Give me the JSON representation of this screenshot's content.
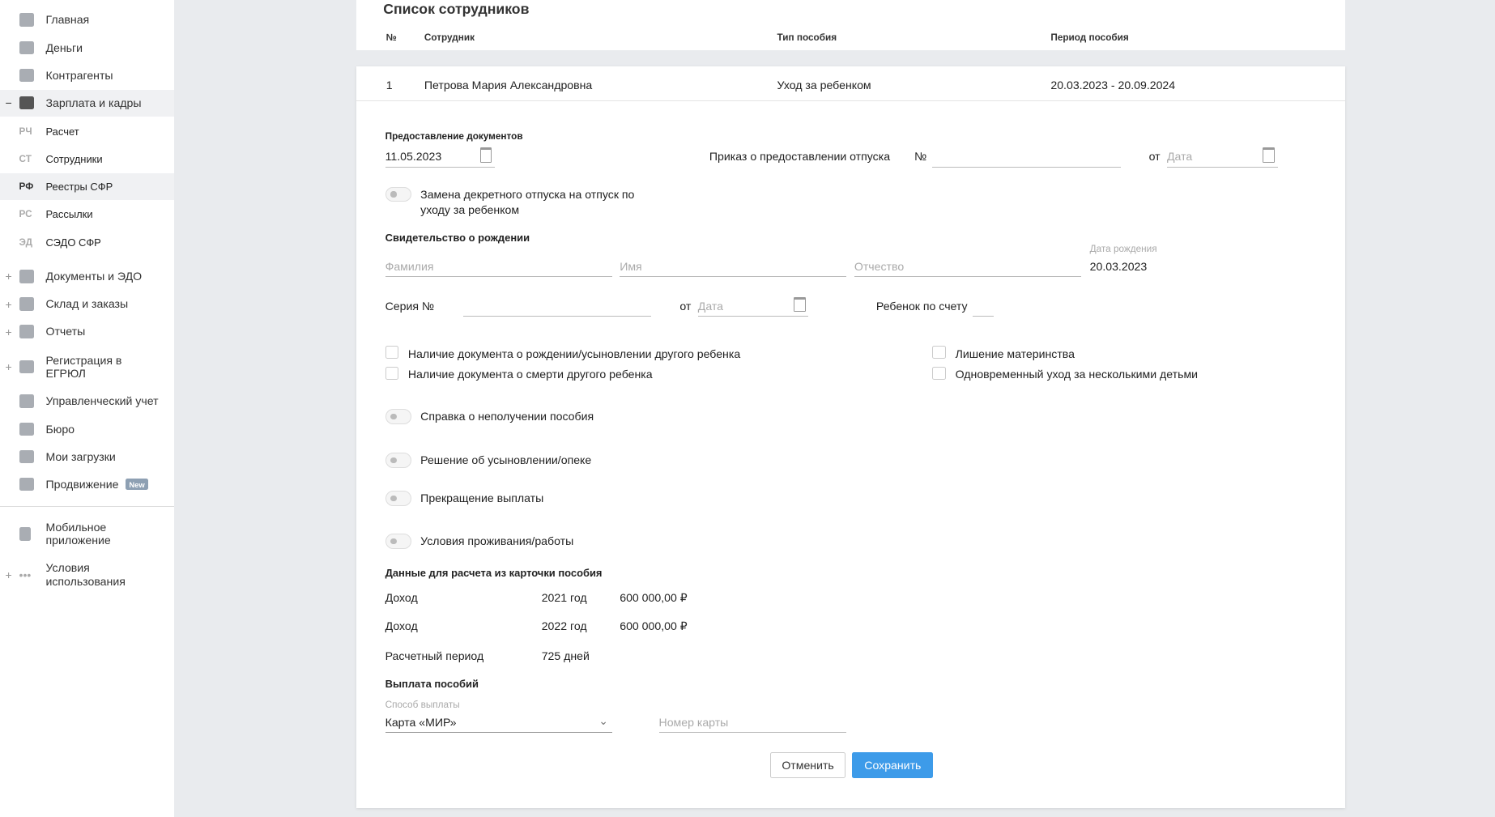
{
  "sidebar": {
    "items": [
      {
        "label": "Главная",
        "icon": "home-icon"
      },
      {
        "label": "Деньги",
        "icon": "money-icon"
      },
      {
        "label": "Контрагенты",
        "icon": "contractors-icon"
      },
      {
        "label": "Зарплата и кадры",
        "icon": "salary-icon",
        "expanded": "−"
      },
      {
        "label": "Документы и ЭДО",
        "icon": "folder-icon",
        "expanded": "+"
      },
      {
        "label": "Склад и заказы",
        "icon": "warehouse-icon",
        "expanded": "+"
      },
      {
        "label": "Отчеты",
        "icon": "reports-icon",
        "expanded": "+"
      },
      {
        "label": "Регистрация в ЕГРЮЛ",
        "icon": "registration-icon",
        "expanded": "+"
      },
      {
        "label": "Управленческий учет",
        "icon": "management-icon"
      },
      {
        "label": "Бюро",
        "icon": "briefcase-icon"
      },
      {
        "label": "Мои загрузки",
        "icon": "folder-icon"
      },
      {
        "label": "Продвижение",
        "icon": "chart-icon",
        "badge": "New"
      },
      {
        "label": "Мобильное приложение",
        "icon": "mobile-icon"
      },
      {
        "label": "Условия использования",
        "icon": "more-icon",
        "expanded": "+"
      }
    ],
    "sub": [
      {
        "abbr": "РЧ",
        "label": "Расчет"
      },
      {
        "abbr": "СТ",
        "label": "Сотрудники"
      },
      {
        "abbr": "РФ",
        "label": "Реестры СФР"
      },
      {
        "abbr": "РС",
        "label": "Рассылки"
      },
      {
        "abbr": "ЭД",
        "label": "СЭДО СФР"
      }
    ]
  },
  "header": {
    "title": "Список сотрудников",
    "cols": [
      "№",
      "Сотрудник",
      "Тип пособия",
      "Период пособия"
    ]
  },
  "row": {
    "num": "1",
    "employee": "Петрова Мария Александровна",
    "type": "Уход за ребенком",
    "period": "20.03.2023 - 20.09.2024"
  },
  "form": {
    "docs_label": "Предоставление документов",
    "docs_date": "11.05.2023",
    "order_label": "Приказ о предоставлении отпуска",
    "num_label": "№",
    "from": "от",
    "date_ph": "Дата",
    "replace_toggle": "Замена декретного отпуска на отпуск по уходу за ребенком",
    "birth_title": "Свидетельство о рождении",
    "surname_ph": "Фамилия",
    "name_ph": "Имя",
    "patronymic_ph": "Отчество",
    "birth_date_label": "Дата рождения",
    "birth_date": "20.03.2023",
    "series_label": "Серия №",
    "child_order": "Ребенок по счету",
    "checks": [
      "Наличие документа о рождении/усыновлении другого ребенка",
      "Наличие документа о смерти другого ребенка",
      "Лишение материнства",
      "Одновременный уход за несколькими детьми"
    ],
    "toggles": [
      "Справка о неполучении пособия",
      "Решение об усыновлении/опеке",
      "Прекращение выплаты",
      "Условия проживания/работы"
    ],
    "calc_title": "Данные для расчета из карточки пособия",
    "calc": [
      {
        "label": "Доход",
        "year": "2021 год",
        "value": "600 000,00 ₽"
      },
      {
        "label": "Доход",
        "year": "2022 год",
        "value": "600 000,00 ₽"
      },
      {
        "label": "Расчетный период",
        "year": "725 дней",
        "value": ""
      }
    ],
    "pay_title": "Выплата пособий",
    "pay_method_label": "Способ выплаты",
    "pay_method": "Карта «МИР»",
    "card_ph": "Номер карты"
  },
  "buttons": {
    "cancel": "Отменить",
    "save": "Сохранить"
  },
  "colors": {
    "accent": "#3d9be9"
  }
}
